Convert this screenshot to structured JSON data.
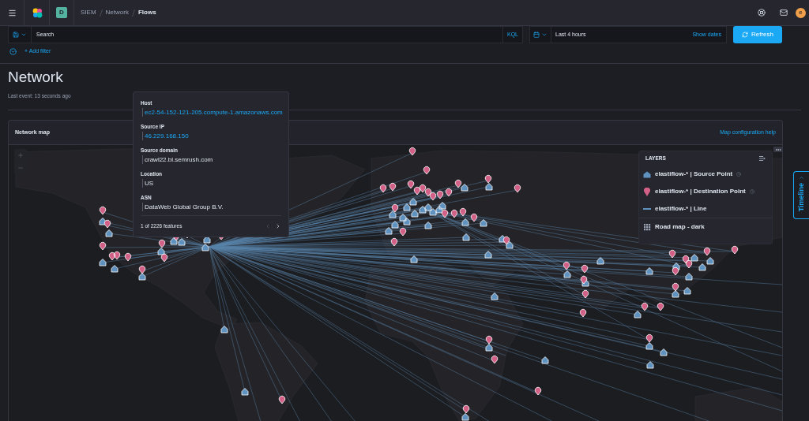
{
  "top_nav": {
    "space_initial": "D",
    "breadcrumbs": [
      {
        "label": "SIEM",
        "current": false
      },
      {
        "label": "Network",
        "current": false
      },
      {
        "label": "Flows",
        "current": true
      }
    ],
    "user_initial": "e"
  },
  "query_bar": {
    "search": {
      "placeholder": "Search"
    },
    "language": "KQL",
    "date_range": "Last 4 hours",
    "show_dates": "Show dates",
    "refresh": "Refresh"
  },
  "filter_bar": {
    "add_filter": "+ Add filter"
  },
  "page_header": {
    "title": "Network",
    "last_event": "Last event: 13 seconds ago"
  },
  "map_panel": {
    "title": "Network map",
    "help_link": "Map configuration help"
  },
  "tooltip": {
    "fields": [
      {
        "label": "Host",
        "value": "ec2-54-152-121-205.compute-1.amazonaws.com",
        "link": true
      },
      {
        "label": "Source IP",
        "value": "46.229.168.150",
        "link": true
      },
      {
        "label": "Source domain",
        "value": "crawl22.bl.semrush.com",
        "link": false
      },
      {
        "label": "Location",
        "value": "US",
        "link": false
      },
      {
        "label": "ASN",
        "value": "DataWeb Global Group B.V.",
        "link": false
      }
    ],
    "pager": {
      "text": "1 of 2226 features",
      "prev_disabled": true,
      "next_disabled": false
    }
  },
  "layers": {
    "title": "LAYERS",
    "items": [
      {
        "kind": "source",
        "label": "elastiflow-* | Source Point",
        "time_filtered": true
      },
      {
        "kind": "destination",
        "label": "elastiflow-* | Destination Point",
        "time_filtered": true
      },
      {
        "kind": "line",
        "label": "elastiflow-* | Line",
        "time_filtered": false
      },
      {
        "kind": "basemap",
        "label": "Road map - dark",
        "time_filtered": false
      }
    ]
  },
  "timeline": {
    "label": "Timeline"
  }
}
